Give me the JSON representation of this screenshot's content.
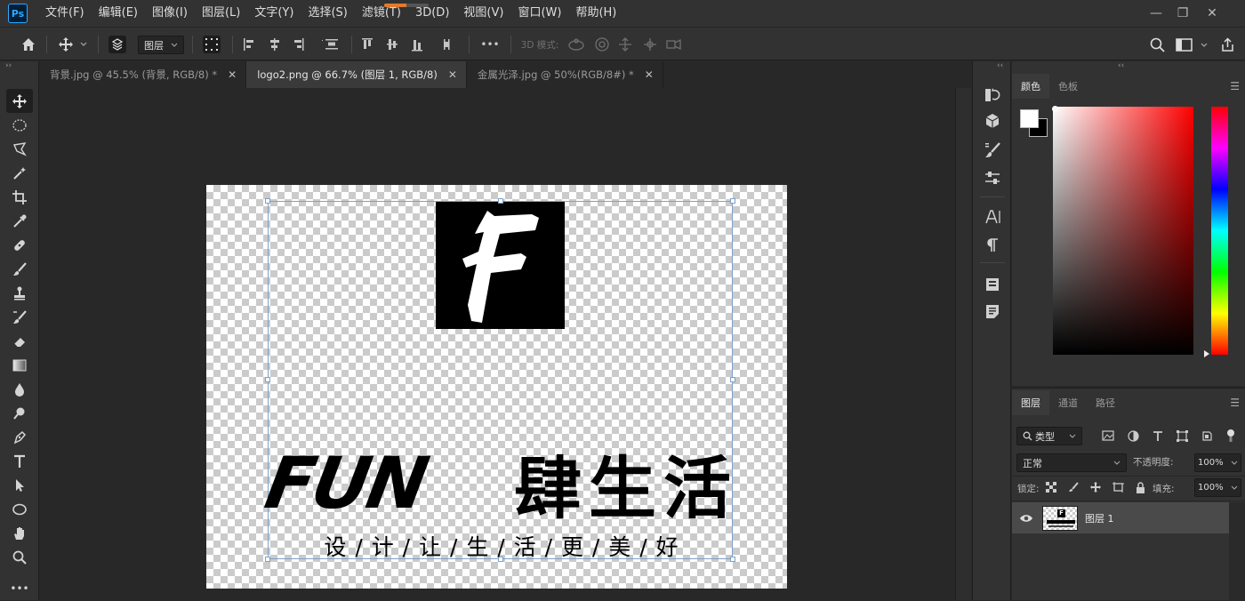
{
  "app": {
    "logo_text": "Ps"
  },
  "menu": [
    "文件(F)",
    "编辑(E)",
    "图像(I)",
    "图层(L)",
    "文字(Y)",
    "选择(S)",
    "滤镜(T)",
    "3D(D)",
    "视图(V)",
    "窗口(W)",
    "帮助(H)"
  ],
  "window_controls": {
    "minimize": "—",
    "restore": "❐",
    "close": "✕"
  },
  "progress_fraction": 0.5,
  "options_bar": {
    "auto_select_target": "图层",
    "mode_label": "3D 模式:",
    "more": "•••"
  },
  "tabs": [
    {
      "label": "背景.jpg @ 45.5% (背景, RGB/8) *",
      "close": "✕",
      "active": false
    },
    {
      "label": "logo2.png @ 66.7% (图层 1, RGB/8)",
      "close": "✕",
      "active": true
    },
    {
      "label": "金属光泽.jpg @ 50%(RGB/8#) *",
      "close": "✕",
      "active": false
    }
  ],
  "canvas": {
    "logo_letter": "F",
    "headline_latin": "FUN",
    "headline_cjk": "肆生活",
    "tagline": "设 / 计 / 让 / 生 / 活 / 更 / 美 / 好"
  },
  "color_panel": {
    "tabs": [
      "颜色",
      "色板"
    ],
    "foreground": "#ffffff",
    "background": "#000000",
    "hue_color": "#ff0000"
  },
  "layers_panel": {
    "tabs": [
      "图层",
      "通道",
      "路径"
    ],
    "filter_label": "类型",
    "blend_mode": "正常",
    "opacity_label": "不透明度:",
    "opacity_value": "100%",
    "lock_label": "锁定:",
    "fill_label": "填充:",
    "fill_value": "100%",
    "layers": [
      {
        "name": "图层 1",
        "visible": true,
        "thumb_letter": "F"
      }
    ]
  },
  "colors": {
    "accent": "#31a8ff",
    "panel": "#323232",
    "canvas_bg": "#282828"
  }
}
